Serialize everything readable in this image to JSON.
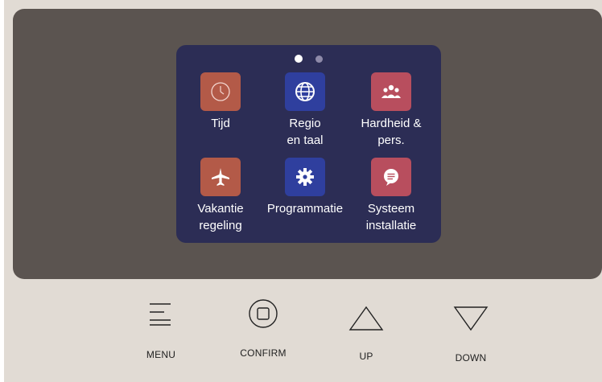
{
  "screen": {
    "page_indicator": {
      "current": 1,
      "total": 2
    },
    "tiles": [
      {
        "id": "tijd",
        "line1": "Tijd",
        "line2": "",
        "icon": "clock-icon",
        "color": "#b35a48"
      },
      {
        "id": "regio",
        "line1": "Regio",
        "line2": "en taal",
        "icon": "globe-icon",
        "color": "#2f3f9e"
      },
      {
        "id": "hardheid",
        "line1": "Hardheid &",
        "line2": "pers.",
        "icon": "people-icon",
        "color": "#b84e5e"
      },
      {
        "id": "vakantie",
        "line1": "Vakantie",
        "line2": "regeling",
        "icon": "airplane-icon",
        "color": "#b35a48"
      },
      {
        "id": "programmatie",
        "line1": "Programmatie",
        "line2": "",
        "icon": "gear-icon",
        "color": "#2f3f9e"
      },
      {
        "id": "systeem",
        "line1": "Systeem",
        "line2": "installatie",
        "icon": "chat-icon",
        "color": "#b84e5e"
      }
    ]
  },
  "buttons": {
    "menu": "MENU",
    "confirm": "CONFIRM",
    "up": "UP",
    "down": "DOWN"
  },
  "colors": {
    "body": "#e1dbd4",
    "bezel": "#5b5450",
    "screen": "#2c2d55"
  }
}
